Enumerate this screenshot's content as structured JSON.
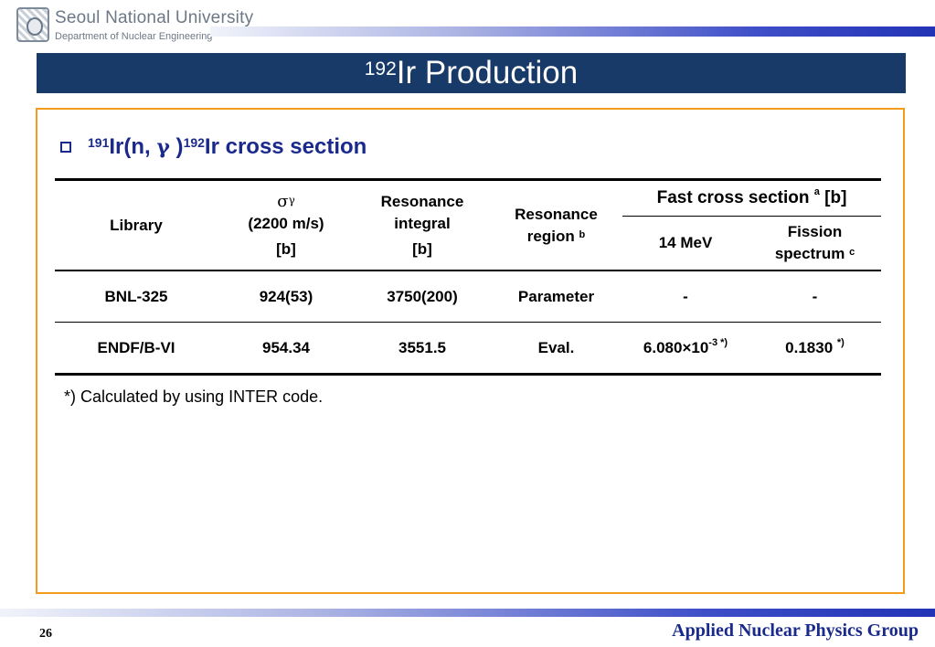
{
  "header": {
    "university": "Seoul National University",
    "department": "Department of Nuclear Engineering"
  },
  "title": {
    "mass_number": "192",
    "text": "Ir Production"
  },
  "section": {
    "sup1": "191",
    "part1": "Ir(n, ",
    "gamma": "γ",
    "part2": " )",
    "sup2": "192",
    "part3": "Ir cross section"
  },
  "table": {
    "headers": {
      "library": "Library",
      "sigma": "σ",
      "sigma_sub": "γ",
      "sigma_line2": "(2200 m/s)",
      "sigma_unit": "[b]",
      "resonance_integral_line1": "Resonance",
      "resonance_integral_line2": "integral",
      "resonance_integral_unit": "[b]",
      "resonance_region_line1": "Resonance",
      "resonance_region_line2": "region",
      "resonance_region_note": "b",
      "fast_cross_section": "Fast cross section",
      "fast_note": "a",
      "fast_unit": "[b]",
      "mev14": "14 MeV",
      "fission_line1": "Fission",
      "fission_line2": "spectrum",
      "fission_note": "c"
    },
    "rows": [
      {
        "library": "BNL-325",
        "sigma": "924(53)",
        "resonance_integral": "3750(200)",
        "resonance_region": "Parameter",
        "mev14": "-",
        "fission": "-"
      },
      {
        "library": "ENDF/B-VI",
        "sigma": "954.34",
        "resonance_integral": "3551.5",
        "resonance_region": "Eval.",
        "mev14_base": "6.080×10",
        "mev14_exp": "-3",
        "mev14_note": "*)",
        "fission": "0.1830",
        "fission_note": "*)"
      }
    ]
  },
  "footnote": "*) Calculated by using INTER code.",
  "footer": {
    "page_number": "26",
    "group": "Applied Nuclear Physics Group"
  },
  "colors": {
    "banner": "#183a68",
    "frame": "#f29c1c",
    "heading": "#1a2a8c"
  }
}
